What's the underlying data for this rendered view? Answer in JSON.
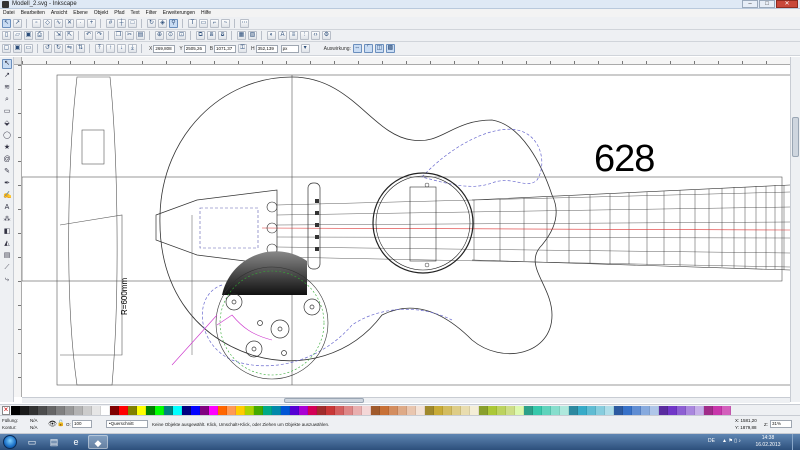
{
  "window": {
    "title": "Modell_2.svg - Inkscape",
    "buttons": {
      "minimize": "–",
      "maximize": "□",
      "close": "✕"
    }
  },
  "menu": [
    "Datei",
    "Bearbeiten",
    "Ansicht",
    "Ebene",
    "Objekt",
    "Pfad",
    "Text",
    "Filter",
    "Erweiterungen",
    "Hilfe"
  ],
  "toolbar2_icons": [
    "new-icon",
    "open-icon",
    "save-icon",
    "print-icon",
    "import-icon",
    "export-icon",
    "undo-icon",
    "redo-icon",
    "copy-icon",
    "cut-icon",
    "paste-icon",
    "zoom-selection-icon",
    "zoom-drawing-icon",
    "zoom-page-icon",
    "duplicate-icon",
    "clone-icon",
    "unlink-icon",
    "group-icon",
    "ungroup-icon",
    "fill-stroke-icon",
    "text-font-icon",
    "layers-icon",
    "align-icon",
    "xml-editor-icon",
    "preferences-icon"
  ],
  "coords": {
    "x_label": "X",
    "x_value": "269,808",
    "y_label": "Y",
    "y_value": "2505,26",
    "w_label": "B",
    "w_value": "1071,37",
    "h_label": "H",
    "h_value": "352,139",
    "unit": "px",
    "affect_label": "Auswirkung:"
  },
  "canvas": {
    "big_number": "628",
    "dim_label": "R=600mm"
  },
  "status": {
    "fill_label": "Füllung:",
    "stroke_label": "Kontur:",
    "fill_value": "N/A",
    "stroke_value": "N/A",
    "opacity_label": "O:",
    "opacity_value": "100",
    "layer": "•Querschnitt",
    "message": "Keine Objekte ausgewählt. Klick, Umschalt+Klick, oder Ziehen um Objekte auszuwählen.",
    "cursor_x": "X: 1581,20",
    "cursor_y": "Y: 1879,88",
    "zoom_label": "Z:",
    "zoom": "31%"
  },
  "taskbar": {
    "lang": "DE",
    "time": "14:38",
    "date": "16.02.2013"
  },
  "palette_colors": [
    "#000000",
    "#1a1a1a",
    "#333333",
    "#4d4d4d",
    "#666666",
    "#808080",
    "#999999",
    "#b3b3b3",
    "#cccccc",
    "#e6e6e6",
    "#ffffff",
    "#800000",
    "#ff0000",
    "#808000",
    "#ffff00",
    "#008000",
    "#00ff00",
    "#008080",
    "#00ffff",
    "#000080",
    "#0000ff",
    "#800080",
    "#ff00ff",
    "#ff6600",
    "#ff9955",
    "#ffcc00",
    "#aad400",
    "#44aa00",
    "#00aa88",
    "#0088aa",
    "#0055d4",
    "#5500d4",
    "#aa00d4",
    "#d40055",
    "#a02c2c",
    "#c83737",
    "#d35f5f",
    "#de8787",
    "#e9afaf",
    "#f4d7d7",
    "#a05a2c",
    "#c87137",
    "#d38d5f",
    "#deaa87",
    "#e9c6af",
    "#f4e3d7",
    "#a0892c",
    "#c8ab37",
    "#d3bc5f",
    "#decd87",
    "#e9ddaf",
    "#f4eed7",
    "#89a02c",
    "#abc837",
    "#bcd35f",
    "#cdde87",
    "#ddf9af",
    "#2ca089",
    "#37c8ab",
    "#5fd3bc",
    "#87decd",
    "#afe9dd",
    "#2c89a0",
    "#37abc8",
    "#5fbcd3",
    "#87cdde",
    "#afdde9",
    "#2c5aa0",
    "#3771c8",
    "#5f8dd3",
    "#87aade",
    "#afc6e9",
    "#5a2ca0",
    "#7137c8",
    "#8d5fd3",
    "#aa87de",
    "#c6afe9",
    "#a02c89",
    "#c837ab",
    "#d35fbc"
  ]
}
